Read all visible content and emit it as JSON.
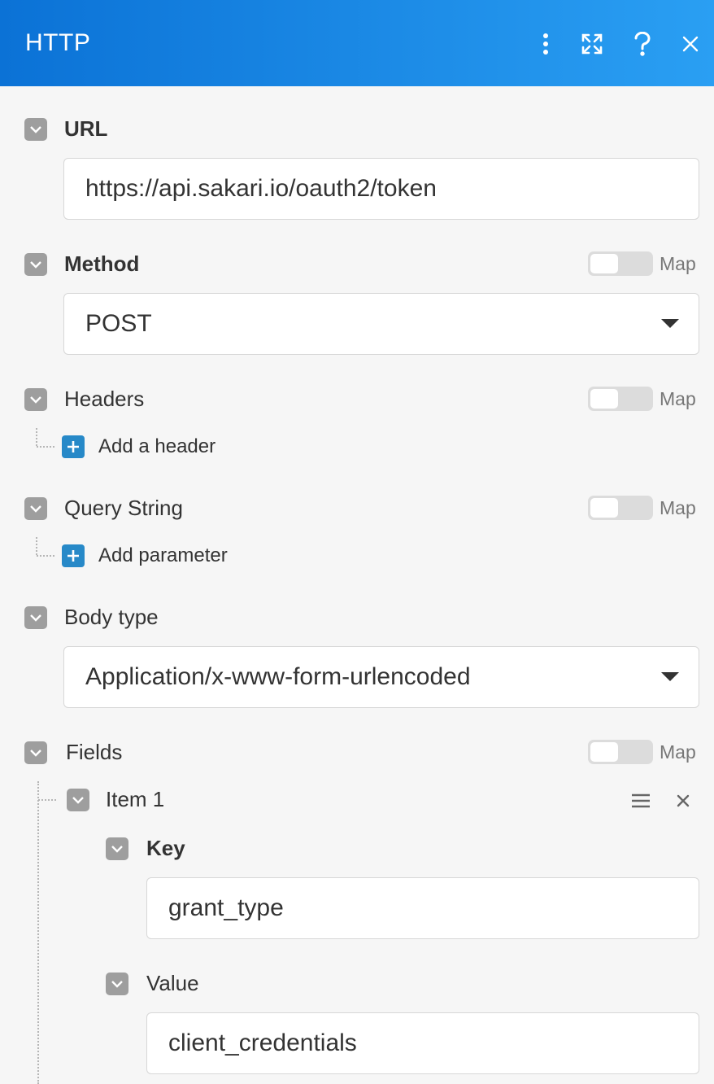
{
  "header": {
    "title": "HTTP",
    "icons": [
      "more-vert-icon",
      "expand-icon",
      "help-icon",
      "close-icon"
    ]
  },
  "url": {
    "label": "URL",
    "value": "https://api.sakari.io/oauth2/token"
  },
  "method": {
    "label": "Method",
    "value": "POST",
    "map_label": "Map"
  },
  "headers": {
    "label": "Headers",
    "map_label": "Map",
    "add_label": "Add a header"
  },
  "query_string": {
    "label": "Query String",
    "map_label": "Map",
    "add_label": "Add parameter"
  },
  "body_type": {
    "label": "Body type",
    "value": "Application/x-www-form-urlencoded"
  },
  "fields": {
    "label": "Fields",
    "map_label": "Map",
    "items": [
      {
        "label": "Item 1",
        "key": {
          "label": "Key",
          "value": "grant_type"
        },
        "value": {
          "label": "Value",
          "value": "client_credentials"
        }
      }
    ]
  },
  "colors": {
    "header_start": "#0b72d6",
    "header_end": "#2a9ff3",
    "add_button": "#2789c8",
    "chevron_bg": "#9e9e9e"
  }
}
